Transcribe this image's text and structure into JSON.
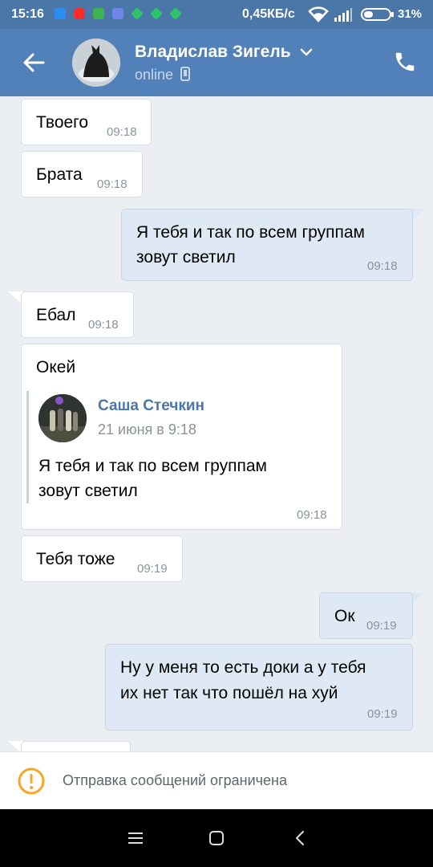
{
  "status_bar": {
    "time": "15:16",
    "speed": "0,45КБ/с",
    "battery": "31%"
  },
  "header": {
    "contact_name": "Владислав Зигель",
    "status": "online"
  },
  "messages": [
    {
      "direction": "in",
      "text": "Твоего",
      "time": "09:18"
    },
    {
      "direction": "in",
      "text": "Брата",
      "time": "09:18"
    },
    {
      "direction": "out",
      "lines": [
        "Я тебя и так по всем группам",
        "зовут светил"
      ],
      "time": "09:18"
    },
    {
      "direction": "in",
      "text": "Ебал",
      "time": "09:18"
    },
    {
      "direction": "in",
      "text": "Окей",
      "time": "09:18",
      "forwarded": {
        "author": "Саша Стечкин",
        "date": "21 июня в 9:18",
        "lines": [
          "Я тебя и так по всем группам",
          "зовут светил"
        ]
      }
    },
    {
      "direction": "in",
      "text": "Тебя тоже",
      "time": "09:19"
    },
    {
      "direction": "out",
      "text": "Ок",
      "time": "09:19"
    },
    {
      "direction": "out",
      "lines": [
        "Ну у меня то есть доки а у тебя",
        "их нет  так что пошёл на хуй"
      ],
      "time": "09:19"
    }
  ],
  "restriction": {
    "text": "Отправка сообщений ограничена"
  },
  "colors": {
    "header": "#5181b8",
    "status_bar": "#4a76a8",
    "incoming_bubble": "#ffffff",
    "outgoing_bubble": "#dfe9f5",
    "background": "#ebeff4",
    "warning": "#f5a623"
  },
  "icons": [
    "back-arrow-icon",
    "chevron-down-icon",
    "phone-icon",
    "mobile-icon",
    "warning-icon",
    "menu-icon",
    "home-icon",
    "nav-back-icon",
    "wifi-icon",
    "signal-icon",
    "battery-icon"
  ]
}
